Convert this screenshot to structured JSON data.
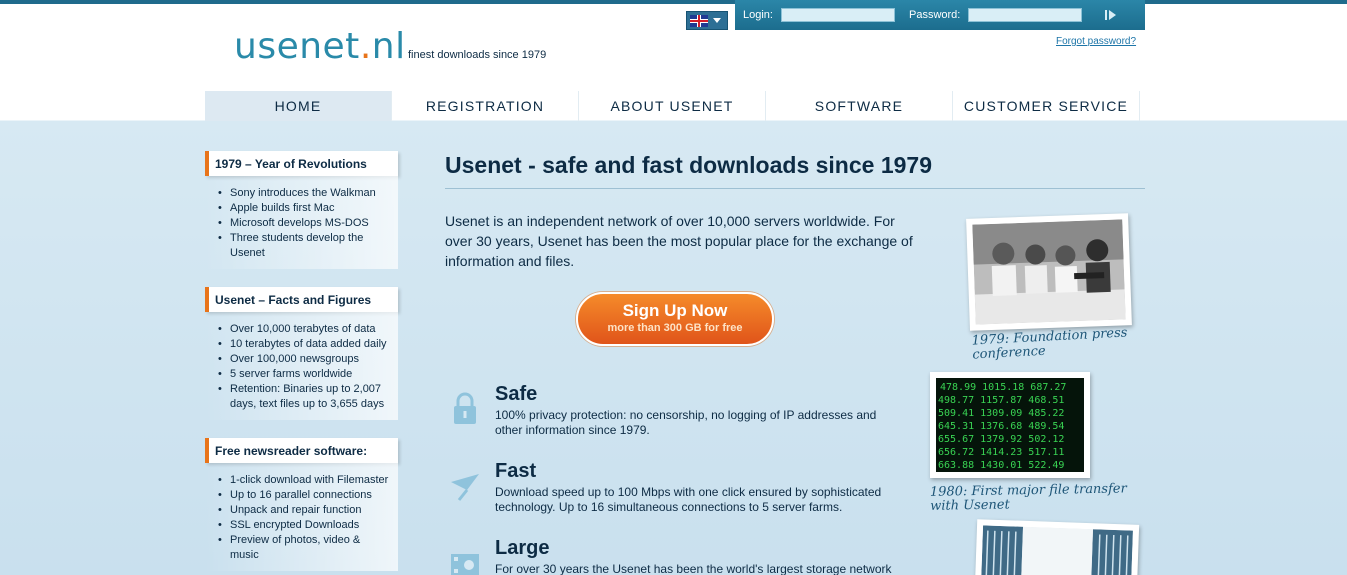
{
  "header": {
    "logo_main": "usenet",
    "logo_dot": ".",
    "logo_tld": "nl",
    "tagline": "finest downloads since 1979",
    "login_label": "Login:",
    "password_label": "Password:",
    "forgot_password": "Forgot password?"
  },
  "nav": {
    "items": [
      {
        "label": "HOME"
      },
      {
        "label": "REGISTRATION"
      },
      {
        "label": "ABOUT USENET"
      },
      {
        "label": "SOFTWARE"
      },
      {
        "label": "CUSTOMER SERVICE"
      }
    ]
  },
  "sidebar": {
    "boxes": [
      {
        "title": "1979 – Year of Revolutions",
        "items": [
          "Sony introduces the Walkman",
          "Apple builds first Mac",
          "Microsoft develops MS-DOS",
          "Three students develop the Usenet"
        ]
      },
      {
        "title": "Usenet – Facts and Figures",
        "items": [
          "Over 10,000 terabytes of data",
          "10 terabytes of data added daily",
          "Over 100,000 newsgroups",
          "5 server farms worldwide",
          "Retention: Binaries up to 2,007 days, text files up to 3,655 days"
        ]
      },
      {
        "title": "Free newsreader software:",
        "items": [
          "1-click download with Filemaster",
          "Up to 16 parallel connections",
          "Unpack and repair function",
          "SSL encrypted Downloads",
          "Preview of photos, video & music"
        ]
      }
    ]
  },
  "main": {
    "title": "Usenet - safe and fast downloads since 1979",
    "intro": "Usenet is an independent network of over 10,000 servers worldwide. For over 30 years, Usenet has been the most popular place for the exchange of information and files.",
    "signup_label": "Sign Up Now",
    "signup_sub": "more than 300 GB for free",
    "features": [
      {
        "icon": "lock-icon",
        "title": "Safe",
        "text": "100% privacy protection: no censorship, no logging of IP addresses and other information since 1979."
      },
      {
        "icon": "paper-plane-icon",
        "title": "Fast",
        "text": "Download speed up to 100 Mbps with one click ensured by sophisticated technology. Up to 16 simultaneous connections to 5 server farms."
      },
      {
        "icon": "media-icon",
        "title": "Large",
        "text": "For over 30 years the Usenet has been the world's largest storage network"
      }
    ]
  },
  "photos": [
    {
      "caption": "1979: Foundation press conference"
    },
    {
      "caption": "1980: First major file transfer with Usenet"
    },
    {
      "caption": ""
    }
  ],
  "colors": {
    "accent": "#e8741a",
    "brand": "#2a8aa9",
    "text": "#0d2b44",
    "login_bar": "#2b86a8"
  }
}
